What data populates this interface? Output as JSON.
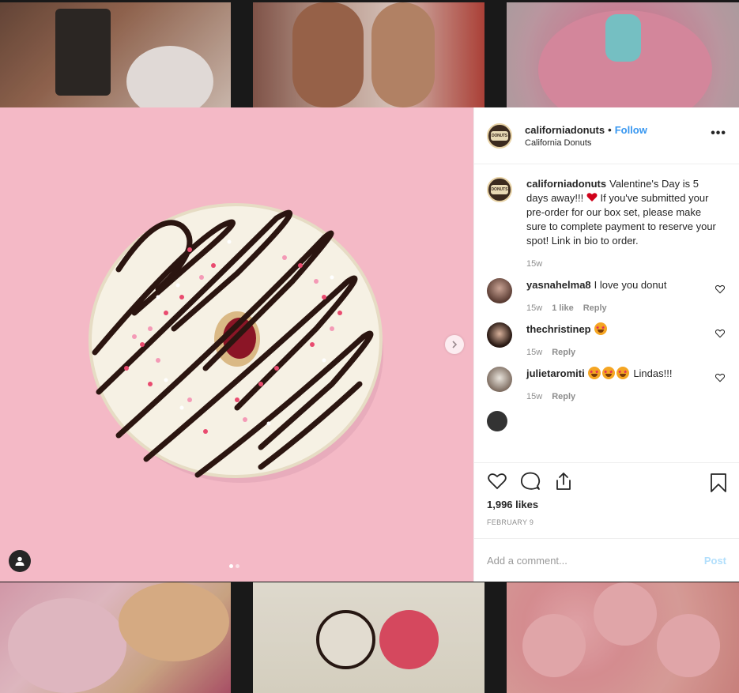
{
  "post": {
    "username": "californiadonuts",
    "follow_label": "Follow",
    "separator": "•",
    "location": "California Donuts",
    "avatar_text": "DONUTS",
    "more_label": "•••",
    "caption": {
      "username": "californiadonuts",
      "text_before_emoji": "Valentine's Day is 5 days away!!!",
      "emoji": "red-heart-emoji",
      "text_after_emoji": "If you've submitted your pre-order for our box set, please make sure to complete payment to reserve your spot! Link in bio to order.",
      "time": "15w"
    },
    "comments": [
      {
        "username": "yasnahelma8",
        "text": "I love you donut",
        "time": "15w",
        "likes": "1 like",
        "reply": "Reply"
      },
      {
        "username": "thechristinep",
        "text": "",
        "emoji": "star-struck-emoji",
        "time": "15w",
        "reply": "Reply"
      },
      {
        "username": "julietaromiti",
        "text": "Lindas!!!",
        "emoji_count": 3,
        "time": "15w",
        "reply": "Reply"
      }
    ],
    "likes": "1,996 likes",
    "date": "FEBRUARY 9",
    "add_comment_placeholder": "Add a comment...",
    "post_label": "Post",
    "carousel": {
      "count": 2,
      "active": 0
    }
  },
  "colors": {
    "accent": "#3897f0",
    "media_bg": "#f4b9c6",
    "post_disabled": "#b2dffc"
  }
}
